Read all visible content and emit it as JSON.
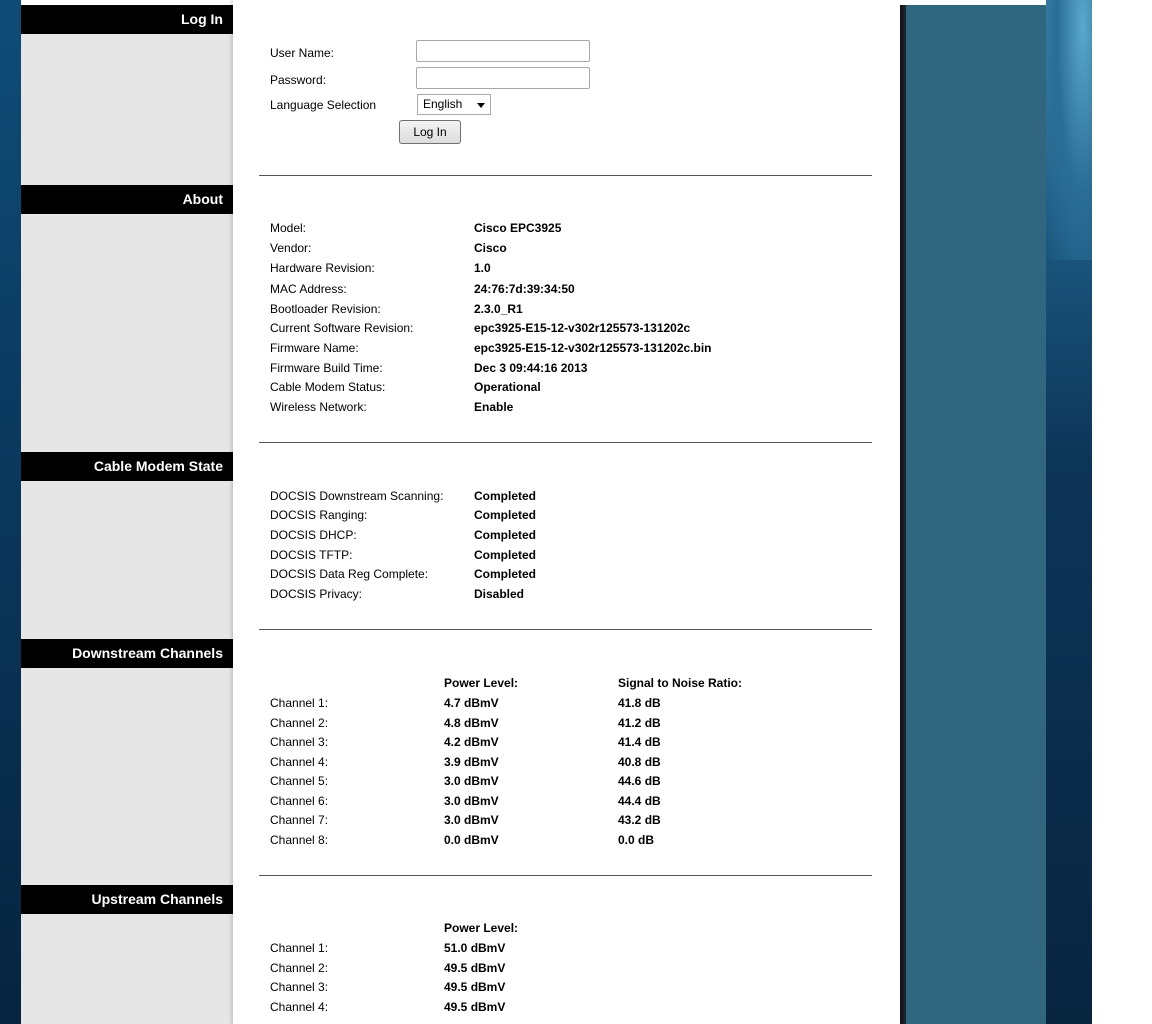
{
  "nav": {
    "login": "Log In",
    "about": "About",
    "cable_modem_state": "Cable Modem State",
    "downstream": "Downstream Channels",
    "upstream": "Upstream Channels"
  },
  "login": {
    "username_label": "User Name:",
    "password_label": "Password:",
    "language_label": "Language Selection",
    "language_value": "English",
    "button_label": "Log In"
  },
  "about": {
    "rows": [
      {
        "label": "Model:",
        "value": "Cisco EPC3925"
      },
      {
        "label": "Vendor:",
        "value": "Cisco"
      },
      {
        "label": "Hardware Revision:",
        "value": "1.0"
      },
      {
        "label": "MAC Address:",
        "value": "24:76:7d:39:34:50"
      },
      {
        "label": "Bootloader Revision:",
        "value": "2.3.0_R1"
      },
      {
        "label": "Current Software Revision:",
        "value": "epc3925-E15-12-v302r125573-131202c"
      },
      {
        "label": "Firmware Name:",
        "value": "epc3925-E15-12-v302r125573-131202c.bin"
      },
      {
        "label": "Firmware Build Time:",
        "value": "Dec 3 09:44:16 2013"
      },
      {
        "label": "Cable Modem Status:",
        "value": "Operational"
      },
      {
        "label": "Wireless Network:",
        "value": "Enable"
      }
    ]
  },
  "cm_state": {
    "rows": [
      {
        "label": "DOCSIS Downstream Scanning:",
        "value": "Completed"
      },
      {
        "label": "DOCSIS Ranging:",
        "value": "Completed"
      },
      {
        "label": "DOCSIS DHCP:",
        "value": "Completed"
      },
      {
        "label": "DOCSIS TFTP:",
        "value": "Completed"
      },
      {
        "label": "DOCSIS Data Reg Complete:",
        "value": "Completed"
      },
      {
        "label": "DOCSIS Privacy:",
        "value": "Disabled"
      }
    ]
  },
  "downstream": {
    "power_header": "Power Level:",
    "snr_header": "Signal to Noise Ratio:",
    "rows": [
      {
        "label": "Channel 1:",
        "power": "4.7 dBmV",
        "snr": "41.8 dB"
      },
      {
        "label": "Channel 2:",
        "power": "4.8 dBmV",
        "snr": "41.2 dB"
      },
      {
        "label": "Channel 3:",
        "power": "4.2 dBmV",
        "snr": "41.4 dB"
      },
      {
        "label": "Channel 4:",
        "power": "3.9 dBmV",
        "snr": "40.8 dB"
      },
      {
        "label": "Channel 5:",
        "power": "3.0 dBmV",
        "snr": "44.6 dB"
      },
      {
        "label": "Channel 6:",
        "power": "3.0 dBmV",
        "snr": "44.4 dB"
      },
      {
        "label": "Channel 7:",
        "power": "3.0 dBmV",
        "snr": "43.2 dB"
      },
      {
        "label": "Channel 8:",
        "power": "0.0 dBmV",
        "snr": "0.0 dB"
      }
    ]
  },
  "upstream": {
    "power_header": "Power Level:",
    "rows": [
      {
        "label": "Channel 1:",
        "power": "51.0 dBmV"
      },
      {
        "label": "Channel 2:",
        "power": "49.5 dBmV"
      },
      {
        "label": "Channel 3:",
        "power": "49.5 dBmV"
      },
      {
        "label": "Channel 4:",
        "power": "49.5 dBmV"
      }
    ]
  }
}
